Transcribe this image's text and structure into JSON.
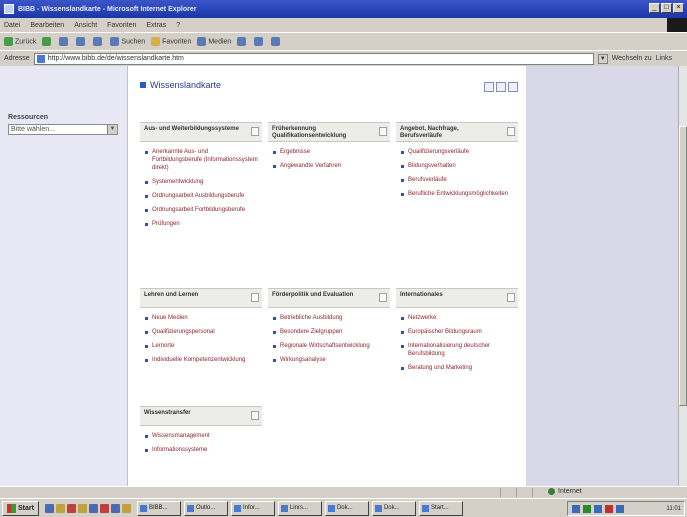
{
  "window": {
    "title": "BIBB - Wissenslandkarte - Microsoft Internet Explorer"
  },
  "menu": [
    "Datei",
    "Bearbeiten",
    "Ansicht",
    "Favoriten",
    "Extras",
    "?"
  ],
  "toolbar": {
    "back": "Zurück",
    "search": "Suchen",
    "favorites": "Favoriten",
    "media": "Medien"
  },
  "address": {
    "label": "Adresse",
    "url": "http://www.bibb.de/de/wissenslandkarte.htm",
    "go": "Wechseln zu",
    "links": "Links"
  },
  "sidebar": {
    "label": "Ressourcen",
    "select_value": "Bitte wählen..."
  },
  "page": {
    "title": "Wissenslandkarte",
    "boxes": [
      {
        "title": "Aus- und Weiterbildungssysteme",
        "items": [
          "Anerkannte Aus- und Fortbildungsberufe (Informationssystem direkt)",
          "Systementwicklung",
          "Ordnungsarbeit Ausbildungsberufe",
          "Ordnungsarbeit Fortbildungsberufe",
          "Prüfungen"
        ]
      },
      {
        "title": "Früherkennung Qualifikationsentwicklung",
        "items": [
          "Ergebnisse",
          "Angewandte Verfahren"
        ]
      },
      {
        "title": "Angebot, Nachfrage, Berufsverläufe",
        "items": [
          "Qualifizierungsverläufe",
          "Bildungsverhalten",
          "Berufsverläufe",
          "Berufliche Entwicklungsmöglichkeiten"
        ]
      },
      {
        "title": "Lehren und Lernen",
        "items": [
          "Neue Medien",
          "Qualifizierungspersonal",
          "Lernorte",
          "Individuelle Kompetenzentwicklung"
        ]
      },
      {
        "title": "Förderpolitik und Evaluation",
        "items": [
          "Betriebliche Ausbildung",
          "Besondere Zielgruppen",
          "Regionale Wirtschaftsentwicklung",
          "Wirkungsanalyse"
        ]
      },
      {
        "title": "Internationales",
        "items": [
          "Netzwerke",
          "Europäischer Bildungsraum",
          "Internationalisierung deutscher Berufsbildung",
          "Beratung und Marketing"
        ]
      },
      {
        "title": "Wissenstransfer",
        "items": [
          "Wissensmanagement",
          "Informationssysteme"
        ]
      }
    ]
  },
  "status": {
    "zone": "Internet"
  },
  "taskbar": {
    "start": "Start",
    "tasks": [
      "BIBB...",
      "Outlo...",
      "Infor...",
      "Linrs...",
      "Dok...",
      "Dok...",
      "Start..."
    ],
    "clock": "11:01"
  }
}
